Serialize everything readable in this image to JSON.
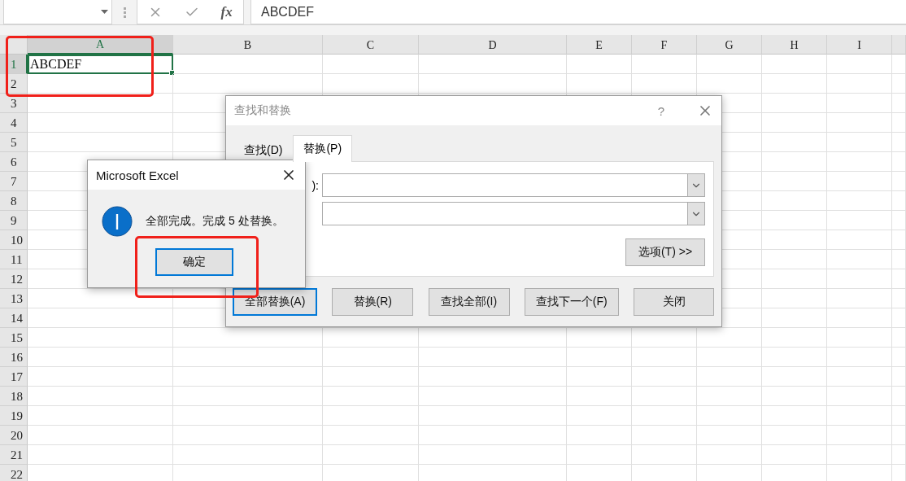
{
  "formula_bar": {
    "formula": "ABCDEF",
    "function_button": "fx"
  },
  "sheet": {
    "columns": [
      {
        "label": "A",
        "selected": true
      },
      {
        "label": "B",
        "selected": false
      },
      {
        "label": "C",
        "selected": false
      },
      {
        "label": "D",
        "selected": false
      },
      {
        "label": "E",
        "selected": false
      },
      {
        "label": "F",
        "selected": false
      },
      {
        "label": "G",
        "selected": false
      },
      {
        "label": "H",
        "selected": false
      },
      {
        "label": "I",
        "selected": false
      }
    ],
    "rows": [
      {
        "label": "1",
        "selected": true,
        "cells": [
          {
            "text": "ABCDEF",
            "selected": true
          }
        ]
      },
      {
        "label": "2",
        "selected": false
      },
      {
        "label": "3",
        "selected": false
      },
      {
        "label": "4",
        "selected": false
      },
      {
        "label": "5",
        "selected": false
      },
      {
        "label": "6",
        "selected": false
      },
      {
        "label": "7",
        "selected": false
      },
      {
        "label": "8",
        "selected": false
      },
      {
        "label": "9",
        "selected": false
      },
      {
        "label": "10",
        "selected": false
      },
      {
        "label": "11",
        "selected": false
      },
      {
        "label": "12",
        "selected": false
      },
      {
        "label": "13",
        "selected": false
      },
      {
        "label": "14",
        "selected": false
      },
      {
        "label": "15",
        "selected": false
      },
      {
        "label": "16",
        "selected": false
      },
      {
        "label": "17",
        "selected": false
      },
      {
        "label": "18",
        "selected": false
      },
      {
        "label": "19",
        "selected": false
      },
      {
        "label": "20",
        "selected": false
      },
      {
        "label": "21",
        "selected": false
      },
      {
        "label": "22",
        "selected": false
      }
    ]
  },
  "find_dialog": {
    "title": "查找和替换",
    "help": "?",
    "tabs": [
      {
        "label": "查找(D)",
        "selected": false
      },
      {
        "label": "替换(P)",
        "selected": true
      }
    ],
    "fields": [
      {
        "kind": "combo",
        "label": "):"
      },
      {
        "kind": "combo"
      }
    ],
    "options_button": "选项(T) >>",
    "buttons": [
      {
        "label": "全部替换(A)",
        "focused": true
      },
      {
        "label": "替换(R)",
        "focused": false
      },
      {
        "label": "查找全部(I)",
        "focused": false
      },
      {
        "label": "查找下一个(F)",
        "focused": false
      },
      {
        "label": "关闭",
        "focused": false
      }
    ]
  },
  "message_box": {
    "title": "Microsoft Excel",
    "kind": "info",
    "message": "全部完成。完成 5 处替换。",
    "button": {
      "label": "确定",
      "focused": true
    }
  },
  "annotations": [
    {
      "kind": "red-box"
    },
    {
      "kind": "red-box"
    }
  ]
}
